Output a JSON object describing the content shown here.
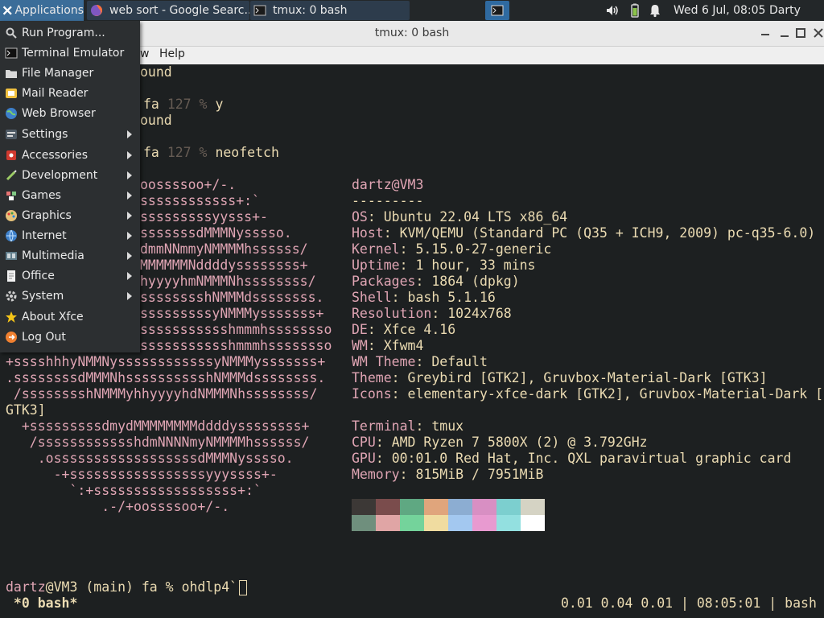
{
  "panel": {
    "applications_label": "Applications",
    "tasks": [
      {
        "label": "web sort - Google Searc..."
      },
      {
        "label": "tmux: 0 bash"
      }
    ],
    "clock": "Wed  6 Jul, 08:05",
    "user": "Darty uwu"
  },
  "window": {
    "title": "tmux: 0 bash",
    "menus": [
      "w",
      "Help"
    ]
  },
  "app_menu": {
    "items": [
      {
        "label": "Run Program...",
        "icon": "search-icon"
      },
      {
        "label": "Terminal Emulator",
        "icon": "terminal-icon"
      },
      {
        "label": "File Manager",
        "icon": "folder-icon"
      },
      {
        "label": "Mail Reader",
        "icon": "mail-icon"
      },
      {
        "label": "Web Browser",
        "icon": "globe-icon"
      },
      {
        "label": "Settings",
        "icon": "settings-icon",
        "submenu": true
      },
      {
        "label": "Accessories",
        "icon": "accessories-icon",
        "submenu": true
      },
      {
        "label": "Development",
        "icon": "development-icon",
        "submenu": true
      },
      {
        "label": "Games",
        "icon": "games-icon",
        "submenu": true
      },
      {
        "label": "Graphics",
        "icon": "graphics-icon",
        "submenu": true
      },
      {
        "label": "Internet",
        "icon": "internet-icon",
        "submenu": true
      },
      {
        "label": "Multimedia",
        "icon": "multimedia-icon",
        "submenu": true
      },
      {
        "label": "Office",
        "icon": "office-icon",
        "submenu": true
      },
      {
        "label": "System",
        "icon": "system-icon",
        "submenu": true
      },
      {
        "label": "About Xfce",
        "icon": "star-icon"
      },
      {
        "label": "Log Out",
        "icon": "logout-icon"
      }
    ]
  },
  "terminal": {
    "history": [
      {
        "text": "ound"
      },
      {
        "cmd_pre": "fa ",
        "code": "127",
        "sep": " % ",
        "cmd": "y"
      },
      {
        "text": "ound"
      },
      {
        "cmd_pre": "fa ",
        "code": "127",
        "sep": " % ",
        "cmd": "neofetch"
      }
    ],
    "logo": [
      "oossssoo+/-.",
      "ssssssssssss+:`",
      "sssssssssyysss+-",
      "sssssssdMMMNysssso.",
      "dmmNNmmyNMMMMhssssss/",
      "MMMMMMNddddyssssssss+",
      "hyyyyhmNMMMNhssssssss/",
      "sssssssshNMMMdssssssss.",
      "sssssssssyNMMMysssssss+",
      "ssssssssssshmmmhssssssso",
      "ssssssssssshmmmhssssssso",
      "+sssshhhyNMMNyssssssssssssyNMMMysssssss+",
      ".ssssssssdMMMNhsssssssssshNMMMdssssssss.",
      " /sssssssshNMMMyhhyyyyhdNMMMNhssssssss/",
      "GTK3]",
      "  +sssssssssdmydMMMMMMMMddddyssssssss+",
      "   /sssssssssssshdmNNNNmyNMMMMhssssss/",
      "    .ossssssssssssssssssdMMMNysssso.",
      "      -+sssssssssssssssssyyyssss+-",
      "        `:+ssssssssssssssssss+:`",
      "            .-/+oossssoo+/-."
    ],
    "info": {
      "user_host": "dartz@VM3",
      "separator": "---------",
      "rows": [
        {
          "key": "OS",
          "value": "Ubuntu 22.04 LTS x86_64"
        },
        {
          "key": "Host",
          "value": "KVM/QEMU (Standard PC (Q35 + ICH9, 2009) pc-q35-6.0)"
        },
        {
          "key": "Kernel",
          "value": "5.15.0-27-generic"
        },
        {
          "key": "Uptime",
          "value": "1 hour, 33 mins"
        },
        {
          "key": "Packages",
          "value": "1864 (dpkg)"
        },
        {
          "key": "Shell",
          "value": "bash 5.1.16"
        },
        {
          "key": "Resolution",
          "value": "1024x768"
        },
        {
          "key": "DE",
          "value": "Xfce 4.16"
        },
        {
          "key": "WM",
          "value": "Xfwm4"
        },
        {
          "key": "WM Theme",
          "value": "Default"
        },
        {
          "key": "Theme",
          "value": "Greybird [GTK2], Gruvbox-Material-Dark [GTK3]"
        },
        {
          "key": "Icons",
          "value": "elementary-xfce-dark [GTK2], Gruvbox-Material-Dark ["
        },
        {
          "key": "",
          "value": ""
        },
        {
          "key": "Terminal",
          "value": "tmux"
        },
        {
          "key": "CPU",
          "value": "AMD Ryzen 7 5800X (2) @ 3.792GHz"
        },
        {
          "key": "GPU",
          "value": "00:01.0 Red Hat, Inc. QXL paravirtual graphic card"
        },
        {
          "key": "Memory",
          "value": "815MiB / 7951MiB"
        }
      ],
      "colors_row1": [
        "#3c3836",
        "#7a4c4c",
        "#5fa882",
        "#e0a57c",
        "#8cadd2",
        "#d88fc3",
        "#7ccfcf",
        "#d5d3c4"
      ],
      "colors_row2": [
        "#6f8f7d",
        "#e0a5a5",
        "#74d39b",
        "#f0dca0",
        "#a3c8f0",
        "#e89ad0",
        "#93e0e0",
        "#ffffff"
      ]
    },
    "prompt": {
      "user": "dartz",
      "host_branch": "@VM3 (main) fa % ",
      "input": "ohdlp4`"
    },
    "status": {
      "left": " *0 bash*",
      "right": "0.01 0.04 0.01 | 08:05:01 | bash"
    }
  },
  "colors": {
    "accent_pink": "#e0a5b4",
    "term_bg": "#1d2021",
    "term_fg": "#ebdbb2",
    "panel_bg": "#232729",
    "menu_bg": "#2c2f31"
  }
}
